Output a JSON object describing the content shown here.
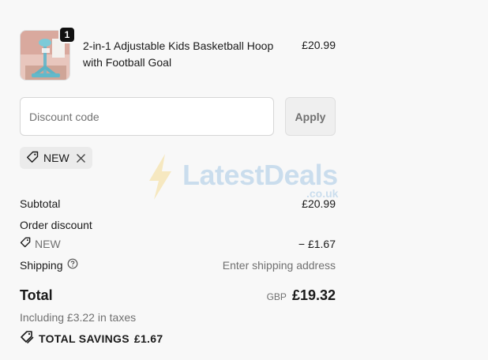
{
  "product": {
    "name": "2-in-1 Adjustable Kids Basketball Hoop with Football Goal",
    "quantity": "1",
    "price": "£20.99"
  },
  "discount": {
    "placeholder": "Discount code",
    "apply_label": "Apply",
    "applied_code": "NEW"
  },
  "watermark": {
    "brand": "LatestDeals",
    "suffix": ".co.uk"
  },
  "summary": {
    "subtotal_label": "Subtotal",
    "subtotal_value": "£20.99",
    "order_discount_label": "Order discount",
    "discount_code": "NEW",
    "discount_value": "− £1.67",
    "shipping_label": "Shipping",
    "shipping_value": "Enter shipping address",
    "total_label": "Total",
    "currency": "GBP",
    "total_value": "£19.32",
    "taxes_text": "Including £3.22 in taxes",
    "savings_label": "TOTAL SAVINGS",
    "savings_value": "£1.67"
  },
  "icons": {
    "tag": "tag-icon",
    "close": "close-icon",
    "help": "question-circle-icon",
    "savings": "double-tag-icon",
    "watermark_bolt": "lightning-bolt-icon"
  },
  "colors": {
    "watermark": "#2a7fc9",
    "bolt": "#f0b400"
  }
}
